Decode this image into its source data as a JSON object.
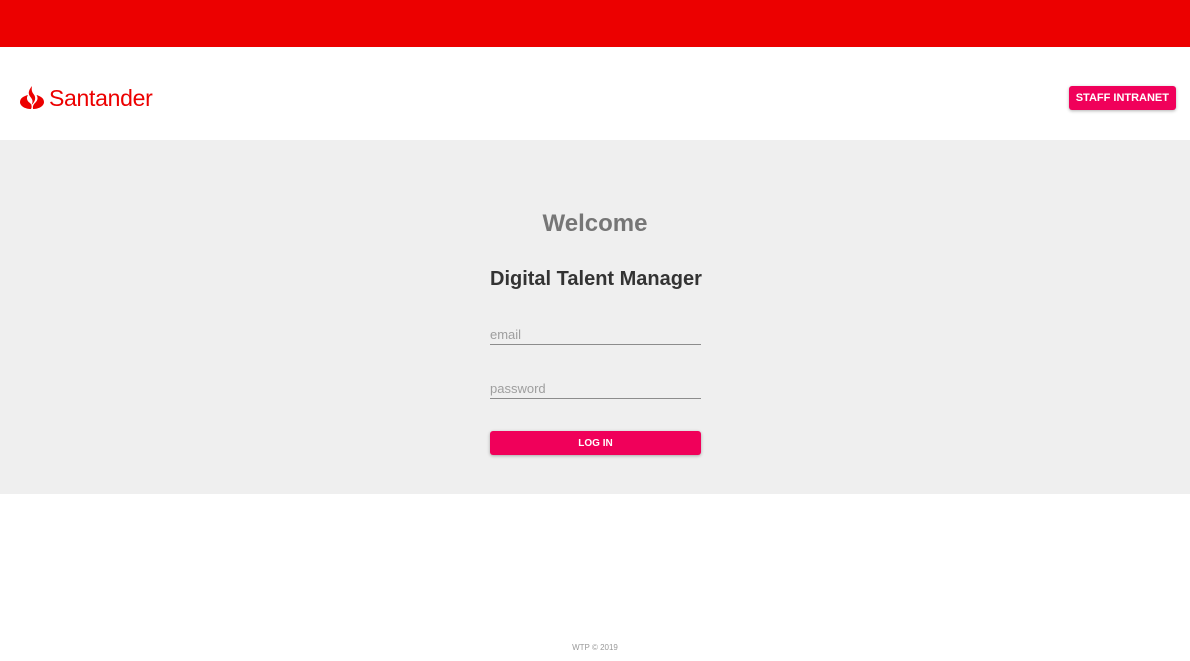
{
  "brand": {
    "name": "Santander",
    "logo_icon": "santander-flame-icon",
    "color": "#ec0000"
  },
  "header": {
    "staff_intranet_label": "STAFF INTRANET"
  },
  "main": {
    "welcome": "Welcome",
    "app_title": "Digital Talent Manager",
    "email_placeholder": "email",
    "email_value": "",
    "password_placeholder": "password",
    "password_value": "",
    "login_label": "LOG IN"
  },
  "footer": {
    "text": "WTP © 2019"
  },
  "colors": {
    "top_bar": "#ec0000",
    "accent_button": "#f0005a",
    "panel_background": "#efefef"
  }
}
